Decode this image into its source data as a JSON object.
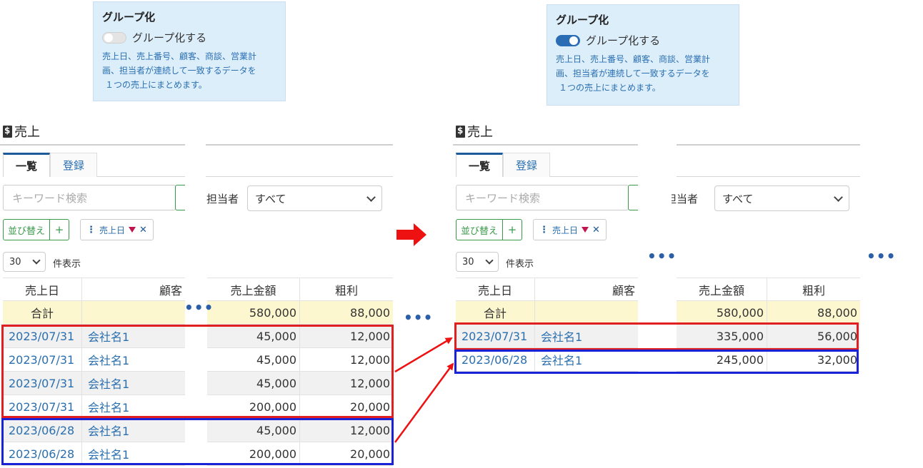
{
  "left": {
    "grouping": {
      "title": "グループ化",
      "toggle_label": "グループ化する",
      "toggle_state": "off",
      "description_lines": [
        "売上日、売上番号、顧客、商談、営業計",
        "画、担当者が連続して一致するデータを",
        "１つの売上にまとめます。"
      ]
    },
    "page_title": "売上",
    "tabs": [
      "一覧",
      "登録"
    ],
    "search_placeholder": "キーワード検索",
    "filter_label": "担当者",
    "filter_value": "すべて",
    "sort_button": "並び替え",
    "sort_add": "+",
    "sort_chip": "売上日",
    "page_size": "30",
    "page_size_suffix": "件表示",
    "columns": [
      "売上日",
      "顧客",
      "売上金額",
      "粗利"
    ],
    "total": {
      "label": "合計",
      "amount": "580,000",
      "profit": "88,000"
    },
    "rows": [
      {
        "date": "2023/07/31",
        "customer": "会社名1",
        "amount": "45,000",
        "profit": "12,000"
      },
      {
        "date": "2023/07/31",
        "customer": "会社名1",
        "amount": "45,000",
        "profit": "12,000"
      },
      {
        "date": "2023/07/31",
        "customer": "会社名1",
        "amount": "45,000",
        "profit": "12,000"
      },
      {
        "date": "2023/07/31",
        "customer": "会社名1",
        "amount": "200,000",
        "profit": "20,000"
      },
      {
        "date": "2023/06/28",
        "customer": "会社名1",
        "amount": "45,000",
        "profit": "12,000"
      },
      {
        "date": "2023/06/28",
        "customer": "会社名1",
        "amount": "200,000",
        "profit": "20,000"
      }
    ]
  },
  "right": {
    "grouping": {
      "title": "グループ化",
      "toggle_label": "グループ化する",
      "toggle_state": "on",
      "description_lines": [
        "売上日、売上番号、顧客、商談、営業計",
        "画、担当者が連続して一致するデータを",
        "１つの売上にまとめます。"
      ]
    },
    "page_title": "売上",
    "tabs": [
      "一覧",
      "登録"
    ],
    "search_placeholder": "キーワード検索",
    "filter_label": "担当者",
    "filter_value": "すべて",
    "sort_button": "並び替え",
    "sort_add": "+",
    "sort_chip": "売上日",
    "page_size": "30",
    "page_size_suffix": "件表示",
    "columns": [
      "売上日",
      "顧客",
      "売上金額",
      "粗利"
    ],
    "total": {
      "label": "合計",
      "amount": "580,000",
      "profit": "88,000"
    },
    "rows": [
      {
        "date": "2023/07/31",
        "customer": "会社名1",
        "amount": "335,000",
        "profit": "56,000"
      },
      {
        "date": "2023/06/28",
        "customer": "会社名1",
        "amount": "245,000",
        "profit": "32,000"
      }
    ]
  },
  "colors": {
    "red_group": "#e02020",
    "blue_group": "#1a22d6",
    "accent": "#2a6fb0"
  }
}
